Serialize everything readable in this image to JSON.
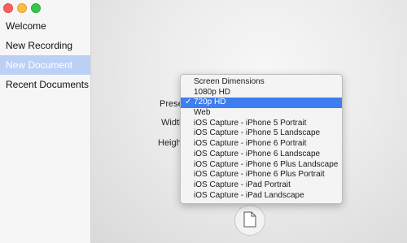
{
  "window": {
    "controls": [
      "close",
      "minimize",
      "zoom"
    ]
  },
  "sidebar": {
    "items": [
      {
        "label": "Welcome"
      },
      {
        "label": "New Recording"
      },
      {
        "label": "New Document",
        "selected": true
      },
      {
        "label": "Recent Documents"
      }
    ]
  },
  "form": {
    "preset_label": "Preset",
    "width_label": "Width",
    "height_label": "Height"
  },
  "preset_menu": {
    "selected": "720p HD",
    "items": [
      "Screen Dimensions",
      "1080p HD",
      "720p HD",
      "Web",
      "iOS Capture - iPhone 5 Portrait",
      "iOS Capture - iPhone 5 Landscape",
      "iOS Capture - iPhone 6 Portrait",
      "iOS Capture - iPhone 6 Landscape",
      "iOS Capture - iPhone 6 Plus Landscape",
      "iOS Capture - iPhone 6 Plus Portrait",
      "iOS Capture - iPad Portrait",
      "iOS Capture - iPad Landscape"
    ]
  },
  "icons": {
    "create_document": "document-icon",
    "selected_check": "checkmark-icon"
  },
  "colors": {
    "selection_blue": "#3d7ef0",
    "sidebar_selection": "#bcd0f5"
  }
}
